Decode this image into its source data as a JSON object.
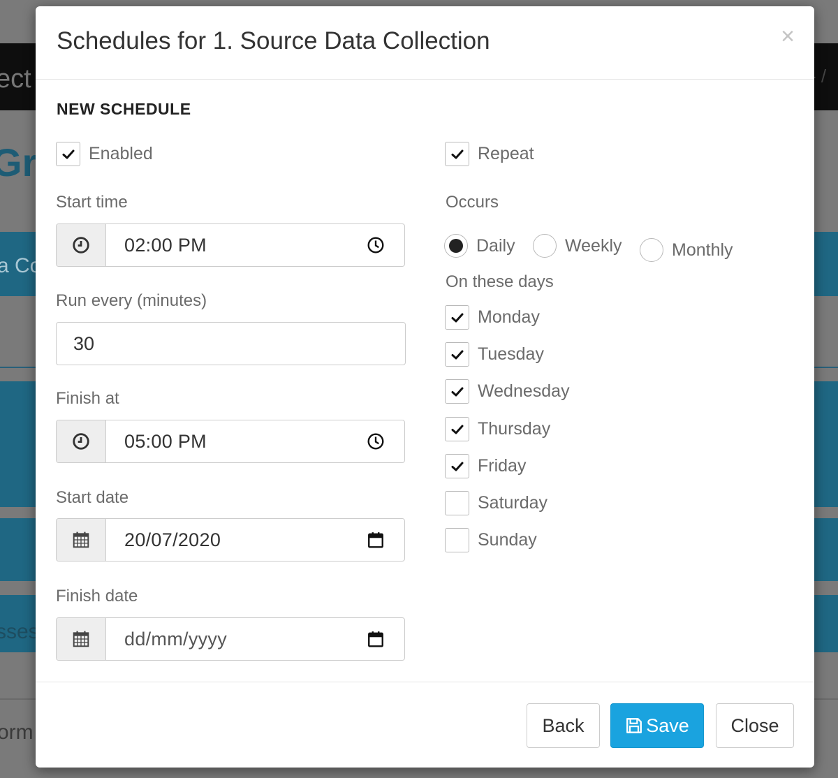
{
  "background": {
    "topbar_text": "ect",
    "heading_text": "Gro",
    "band_text_1": "a Co",
    "band_text_2": "sses",
    "bottom_text": "orm",
    "right_text": "- /"
  },
  "modal": {
    "title": "Schedules for 1. Source Data Collection",
    "close_glyph": "×",
    "section_title": "NEW SCHEDULE",
    "enabled": {
      "label": "Enabled",
      "checked": true
    },
    "start_time": {
      "label": "Start time",
      "value": "02:00  PM"
    },
    "run_every": {
      "label": "Run every (minutes)",
      "value": "30"
    },
    "finish_at": {
      "label": "Finish at",
      "value": "05:00  PM"
    },
    "start_date": {
      "label": "Start date",
      "value": "20/07/2020"
    },
    "finish_date": {
      "label": "Finish date",
      "placeholder": "dd/mm/yyyy"
    },
    "repeat": {
      "label": "Repeat",
      "checked": true
    },
    "occurs": {
      "label": "Occurs",
      "options": [
        {
          "label": "Daily",
          "selected": true
        },
        {
          "label": "Weekly",
          "selected": false
        },
        {
          "label": "Monthly",
          "selected": false
        }
      ]
    },
    "days": {
      "label": "On these days",
      "items": [
        {
          "label": "Monday",
          "checked": true
        },
        {
          "label": "Tuesday",
          "checked": true
        },
        {
          "label": "Wednesday",
          "checked": true
        },
        {
          "label": "Thursday",
          "checked": true
        },
        {
          "label": "Friday",
          "checked": true
        },
        {
          "label": "Saturday",
          "checked": false
        },
        {
          "label": "Sunday",
          "checked": false
        }
      ]
    },
    "footer": {
      "back_label": "Back",
      "save_label": "Save",
      "close_label": "Close"
    }
  },
  "colors": {
    "primary": "#1aa3df",
    "overlay": "#7a7a7a",
    "background_accent": "#1f6783"
  },
  "icons": {
    "time_addon": "clock-icon",
    "date_addon": "calendar-icon",
    "time_picker": "clock-outline-icon",
    "date_picker": "calendar-picker-icon",
    "save": "floppy-disk-icon",
    "check": "checkmark-icon"
  }
}
